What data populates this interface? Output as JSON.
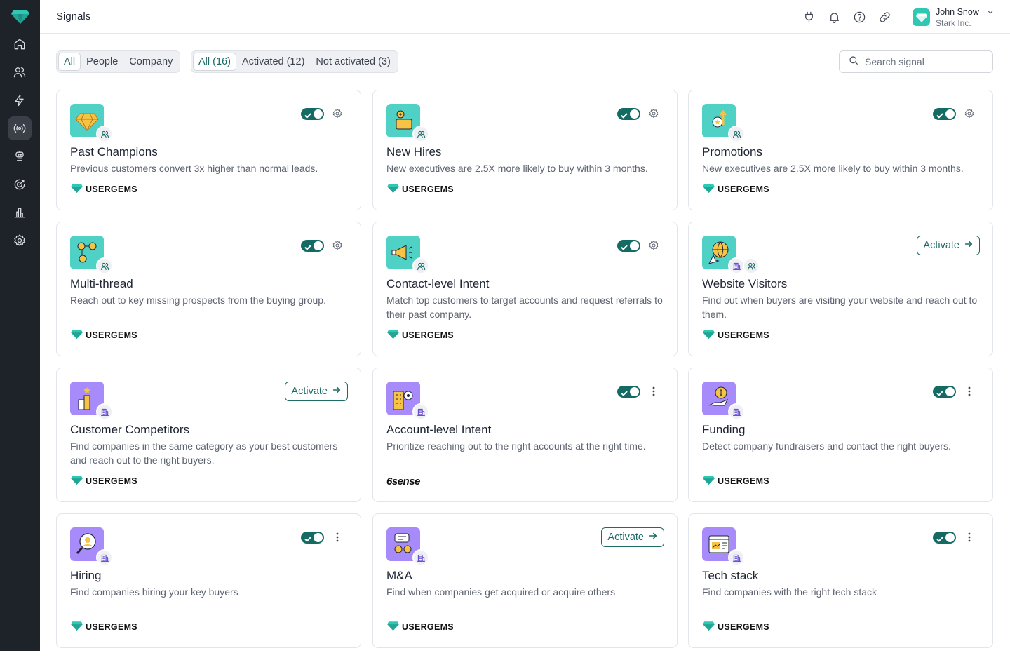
{
  "header": {
    "title": "Signals"
  },
  "user": {
    "name": "John Snow",
    "company": "Stark Inc."
  },
  "filters": {
    "category": [
      {
        "label": "All",
        "selected": true
      },
      {
        "label": "People",
        "selected": false
      },
      {
        "label": "Company",
        "selected": false
      }
    ],
    "status": [
      {
        "label": "All (16)",
        "selected": true
      },
      {
        "label": "Activated (12)",
        "selected": false
      },
      {
        "label": "Not activated (3)",
        "selected": false
      }
    ]
  },
  "search": {
    "placeholder": "Search signal",
    "value": ""
  },
  "activate_label": "Activate",
  "colors": {
    "accent": "#136b63",
    "sidebar": "#1e2229",
    "teal_tile": "#4fd1c5",
    "purple_tile": "#a78bfa"
  },
  "signals": [
    {
      "name": "Past Champions",
      "description": "Previous customers convert 3x higher than normal leads.",
      "provider": "USERGEMS",
      "activated": true,
      "action": "settings",
      "type": "people",
      "icon": "gem-icon"
    },
    {
      "name": "New Hires",
      "description": "New executives are 2.5X more likely to buy within 3 months.",
      "provider": "USERGEMS",
      "activated": true,
      "action": "settings",
      "type": "people",
      "icon": "briefcase-icon"
    },
    {
      "name": "Promotions",
      "description": "New executives are 2.5X more likely to buy within 3 months.",
      "provider": "USERGEMS",
      "activated": true,
      "action": "settings",
      "type": "people",
      "icon": "rising-star-icon"
    },
    {
      "name": "Multi-thread",
      "description": "Reach out to key missing prospects from the buying group.",
      "provider": "USERGEMS",
      "activated": true,
      "action": "settings",
      "type": "people",
      "icon": "people-network-icon"
    },
    {
      "name": "Contact-level Intent",
      "description": "Match top customers to target accounts and request referrals to their past company.",
      "provider": "USERGEMS",
      "activated": true,
      "action": "settings",
      "type": "people",
      "icon": "megaphone-icon"
    },
    {
      "name": "Website Visitors",
      "description": "Find out when buyers are visiting your website and reach out to them.",
      "provider": "USERGEMS",
      "activated": false,
      "action": "activate",
      "type": "both",
      "icon": "globe-cursor-icon"
    },
    {
      "name": "Customer Competitors",
      "description": "Find companies in the same category as your best customers and reach out to the right buyers.",
      "provider": "USERGEMS",
      "activated": false,
      "action": "activate",
      "type": "company",
      "icon": "podium-icon"
    },
    {
      "name": "Account-level Intent",
      "description": "Prioritize reaching out to the right accounts at the right time.",
      "provider": "6sense",
      "activated": true,
      "action": "more",
      "type": "company",
      "icon": "building-target-icon"
    },
    {
      "name": "Funding",
      "description": "Detect company fundraisers and contact the right buyers.",
      "provider": "USERGEMS",
      "activated": true,
      "action": "more",
      "type": "company",
      "icon": "money-hand-icon"
    },
    {
      "name": "Hiring",
      "description": "Find companies hiring your key buyers",
      "provider": "USERGEMS",
      "activated": true,
      "action": "more",
      "type": "company",
      "icon": "magnifier-person-icon"
    },
    {
      "name": "M&A",
      "description": "Find when companies get acquired or acquire others",
      "provider": "USERGEMS",
      "activated": false,
      "action": "activate",
      "type": "company",
      "icon": "chat-people-icon"
    },
    {
      "name": "Tech stack",
      "description": "Find companies with the right tech stack",
      "provider": "USERGEMS",
      "activated": true,
      "action": "more",
      "type": "company",
      "icon": "browser-chart-icon"
    }
  ]
}
